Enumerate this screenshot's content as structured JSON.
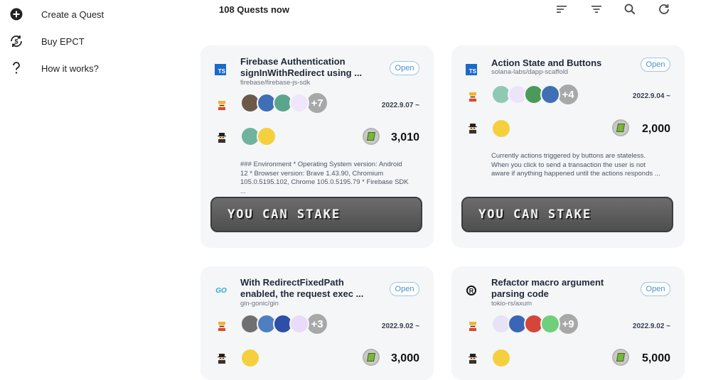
{
  "sidebar": {
    "items": [
      {
        "label": "Create a Quest",
        "icon": "plus-circle-icon"
      },
      {
        "label": "Buy EPCT",
        "icon": "currency-exchange-icon"
      },
      {
        "label": "How it works?",
        "icon": "question-mark-icon"
      }
    ]
  },
  "header": {
    "quest_count": "108 Quests now",
    "tools": [
      "sort-icon",
      "filter-icon",
      "search-icon",
      "refresh-icon"
    ]
  },
  "cards": [
    {
      "lang": "TS",
      "title": "Firebase Authentication signInWithRedirect using ...",
      "repo": "firebase/firebase-js-sdk",
      "status": "Open",
      "extra_count": "+7",
      "date": "2022.9.07 ~",
      "reward": "3,010",
      "description": "### Environment * Operating System version: Android 12 * Browser version: Brave 1.43.90, Chromium 105.0.5195.102, Chrome 105.0.5195.79 * Firebase SDK ...",
      "stake_label": "YOU CAN STAKE"
    },
    {
      "lang": "TS",
      "title": "Action State and Buttons",
      "repo": "solana-labs/dapp-scaffold",
      "status": "Open",
      "extra_count": "+4",
      "date": "2022.9.04 ~",
      "reward": "2,000",
      "description": "Currently actions triggered by buttons are stateless. When you click to send a transaction the user is not aware if anything happened until the actions responds ...",
      "stake_label": "YOU CAN STAKE"
    },
    {
      "lang": "GO",
      "title": "With RedirectFixedPath enabled, the request exec ...",
      "repo": "gin-gonic/gin",
      "status": "Open",
      "extra_count": "+3",
      "date": "2022.9.02 ~",
      "reward": "3,000"
    },
    {
      "lang": "R",
      "title": "Refactor macro argument parsing code",
      "repo": "tokio-rs/axum",
      "status": "Open",
      "extra_count": "+9",
      "date": "2022.9.02 ~",
      "reward": "5,000"
    }
  ],
  "colors": {
    "card_bg": "#f5f6f8",
    "status_border": "#9cc6e8",
    "status_text": "#4a90c8",
    "stake_button": "#5a5a5a",
    "ts_blue": "#1b6ac9",
    "go_cyan": "#29a6d6"
  }
}
